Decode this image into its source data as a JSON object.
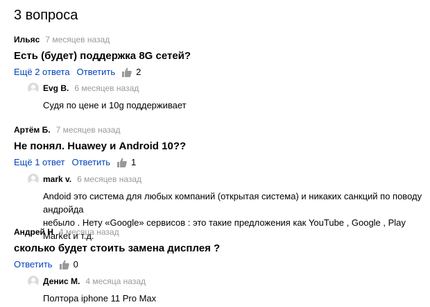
{
  "header": {
    "title": "3 вопроса"
  },
  "questions": [
    {
      "author": "Ильяс",
      "time": "7 месяцев назад",
      "text": "Есть (будет) поддержка 8G сетей?",
      "more_answers": "Ещё 2 ответа",
      "reply_label": "Ответить",
      "likes": "2",
      "answer": {
        "author": "Evg B.",
        "time": "6 месяцев назад",
        "text": "Судя по цене и 10g поддерживает"
      }
    },
    {
      "author": "Артём Б.",
      "time": "7 месяцев назад",
      "text": "Не понял. Huawey и Android 10??",
      "more_answers": "Ещё 1 ответ",
      "reply_label": "Ответить",
      "likes": "1",
      "answer": {
        "author": "mark v.",
        "time": "6 месяцев назад",
        "text_line1": "Andoid это система для любых компаний (открытая система) и никаких санкций по поводу андройда",
        "text_line2": "небыло . Нету «Google» сервисов : это такие предложения как YouTube , Google , Play Market и т.д."
      }
    },
    {
      "author": "Андрей Н",
      "time": "4 месяца назад",
      "text": "сколько будет стоить замена дисплея ?",
      "reply_label": "Ответить",
      "likes": "0",
      "answer": {
        "author": "Денис М.",
        "time": "4 месяца назад",
        "text": "Полтора iphone 11 Pro Max"
      }
    }
  ],
  "colors": {
    "link": "#0044bb",
    "muted": "#999999",
    "avatar": "#dcdcdc"
  },
  "icons": {
    "like": "thumbs-up-icon",
    "avatar": "user-avatar-icon"
  }
}
